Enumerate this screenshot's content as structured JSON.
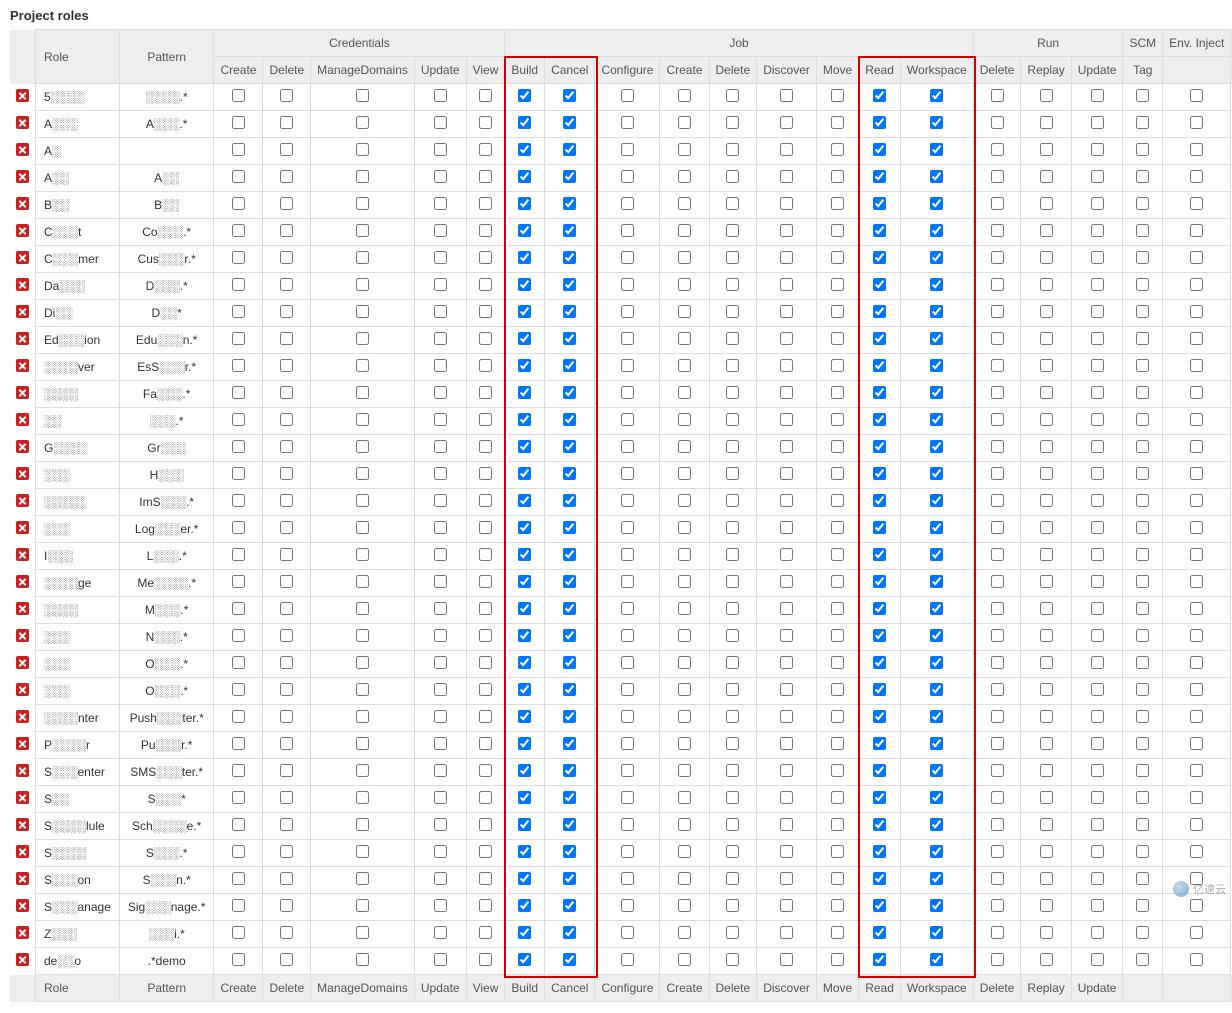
{
  "section_title": "Project roles",
  "header_groups": [
    {
      "label": "Role",
      "colspan": 1,
      "rowspan": 2
    },
    {
      "label": "Pattern",
      "colspan": 1,
      "rowspan": 2
    },
    {
      "label": "Credentials",
      "colspan": 5,
      "rowspan": 1
    },
    {
      "label": "Job",
      "colspan": 9,
      "rowspan": 1
    },
    {
      "label": "Run",
      "colspan": 3,
      "rowspan": 1
    },
    {
      "label": "SCM",
      "colspan": 1,
      "rowspan": 1
    },
    {
      "label": "Env. Inject",
      "colspan": 1,
      "rowspan": 1
    }
  ],
  "columns": [
    "Create",
    "Delete",
    "ManageDomains",
    "Update",
    "View",
    "Build",
    "Cancel",
    "Configure",
    "Create",
    "Delete",
    "Discover",
    "Move",
    "Read",
    "Workspace",
    "Delete",
    "Replay",
    "Update",
    "Tag",
    ""
  ],
  "footer_columns": [
    "Create",
    "Delete",
    "ManageDomains",
    "Update",
    "View",
    "Build",
    "Cancel",
    "Configure",
    "Create",
    "Delete",
    "Discover",
    "Move",
    "Read",
    "Workspace",
    "Delete",
    "Replay",
    "Update",
    "",
    ""
  ],
  "footer_role": "Role",
  "footer_pattern": "Pattern",
  "checked_column_indices": [
    5,
    6,
    12,
    13
  ],
  "highlight_column_ranges": [
    [
      5,
      6
    ],
    [
      12,
      13
    ]
  ],
  "rows": [
    {
      "role": "5░░░░",
      "pattern": "░░░░.*"
    },
    {
      "role": "A░░░",
      "pattern": "A░░░.*"
    },
    {
      "role": "A░",
      "pattern": ""
    },
    {
      "role": "A░░",
      "pattern": "A░░"
    },
    {
      "role": "B░░",
      "pattern": "B░░"
    },
    {
      "role": "C░░░t",
      "pattern": "Co░░░.*"
    },
    {
      "role": "C░░░mer",
      "pattern": "Cus░░░r.*"
    },
    {
      "role": "Da░░░",
      "pattern": "D░░░.*"
    },
    {
      "role": "Di░░",
      "pattern": "D░░*"
    },
    {
      "role": "Ed░░░ion",
      "pattern": "Edu░░░n.*"
    },
    {
      "role": "░░░░ver",
      "pattern": "EsS░░░r.*"
    },
    {
      "role": "░░░░",
      "pattern": "Fa░░░.*"
    },
    {
      "role": "░░",
      "pattern": "░░░.*"
    },
    {
      "role": "G░░░░",
      "pattern": "Gr░░░"
    },
    {
      "role": "░░░",
      "pattern": "H░░░"
    },
    {
      "role": "░░░░░",
      "pattern": "ImS░░░.*"
    },
    {
      "role": "░░░",
      "pattern": "Log░░░er.*"
    },
    {
      "role": "I░░░",
      "pattern": "L░░░.*"
    },
    {
      "role": "░░░░ge",
      "pattern": "Me░░░░.*"
    },
    {
      "role": "░░░░",
      "pattern": "M░░░.*"
    },
    {
      "role": "░░░",
      "pattern": "N░░░.*"
    },
    {
      "role": "░░░",
      "pattern": "O░░░.*"
    },
    {
      "role": "░░░",
      "pattern": "O░░░.*"
    },
    {
      "role": "░░░░nter",
      "pattern": "Push░░░ter.*"
    },
    {
      "role": "P░░░░r",
      "pattern": "Pu░░░r.*"
    },
    {
      "role": "S░░░enter",
      "pattern": "SMS░░░ter.*"
    },
    {
      "role": "S░░",
      "pattern": "S░░░*"
    },
    {
      "role": "S░░░░lule",
      "pattern": "Sch░░░░e.*"
    },
    {
      "role": "S░░░░",
      "pattern": "S░░░.*"
    },
    {
      "role": "S░░░on",
      "pattern": "S░░░n.*"
    },
    {
      "role": "S░░░anage",
      "pattern": "Sig░░░nage.*"
    },
    {
      "role": "Z░░░",
      "pattern": "░░░i.*"
    },
    {
      "role": "de░░o",
      "pattern": ".*demo"
    }
  ],
  "watermark": "亿速云"
}
